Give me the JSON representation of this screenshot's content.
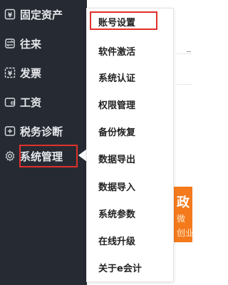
{
  "sidebar": {
    "items": [
      {
        "label": "固定资产",
        "icon": "fixed-asset-icon"
      },
      {
        "label": "往来",
        "icon": "transfer-icon"
      },
      {
        "label": "发票",
        "icon": "yen-icon"
      },
      {
        "label": "工资",
        "icon": "wallet-icon"
      },
      {
        "label": "税务诊断",
        "icon": "tax-diagnosis-icon"
      },
      {
        "label": "系统管理",
        "icon": "gear-icon",
        "active": true
      }
    ]
  },
  "submenu": {
    "items": [
      {
        "label": "账号设置",
        "highlighted": true
      },
      {
        "label": "软件激活"
      },
      {
        "label": "系统认证"
      },
      {
        "label": "权限管理"
      },
      {
        "label": "备份恢复"
      },
      {
        "label": "数据导出"
      },
      {
        "label": "数据导入"
      },
      {
        "label": "系统参数"
      },
      {
        "label": "在线升级"
      },
      {
        "label": "关于e会计"
      }
    ]
  },
  "promo": {
    "title": "政",
    "line1": "微",
    "line2": "创业"
  },
  "colors": {
    "sidebar_bg": "#262b33",
    "highlight_red": "#e0302c",
    "promo_orange": "#f47a1c"
  }
}
